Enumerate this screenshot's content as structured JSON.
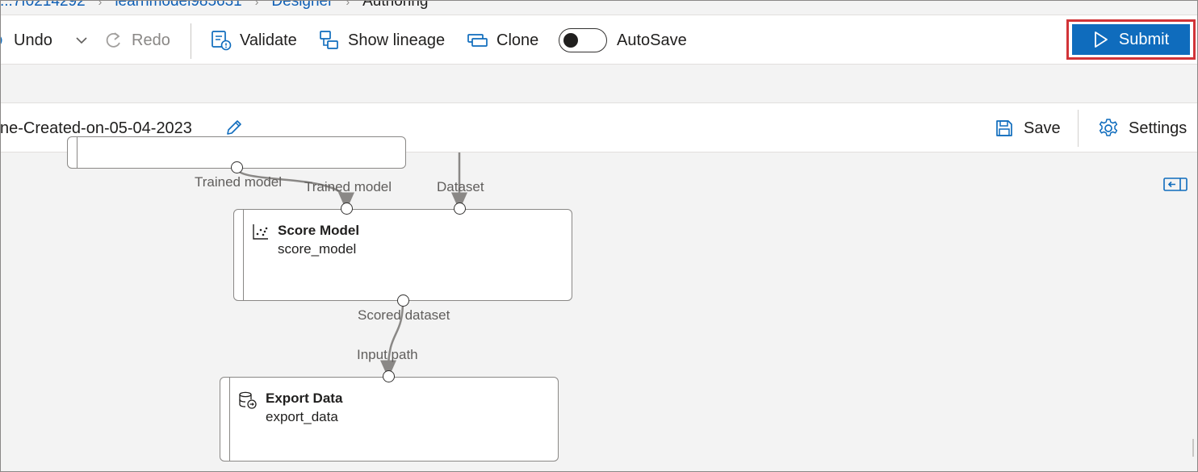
{
  "breadcrumb": {
    "items": [
      "...7f0214292",
      "learnmodel985631",
      "Designer",
      "Authoring"
    ]
  },
  "toolbar": {
    "undo_label": "Undo",
    "redo_label": "Redo",
    "validate_label": "Validate",
    "show_lineage_label": "Show lineage",
    "clone_label": "Clone",
    "autosave_label": "AutoSave",
    "autosave_on": false,
    "submit_label": "Submit"
  },
  "pipeline": {
    "name": "ne-Created-on-05-04-2023",
    "save_label": "Save",
    "settings_label": "Settings"
  },
  "canvas": {
    "port_labels": {
      "upper_output": "Trained model",
      "score_input_model": "Trained model",
      "score_input_dataset": "Dataset",
      "score_output": "Scored dataset",
      "export_input": "Input path"
    },
    "nodes": {
      "score_model": {
        "title": "Score Model",
        "subtitle": "score_model"
      },
      "export_data": {
        "title": "Export Data",
        "subtitle": "export_data"
      }
    }
  },
  "colors": {
    "accent": "#0f6cbd",
    "highlight": "#d13438",
    "link": "#0f5fb5"
  }
}
